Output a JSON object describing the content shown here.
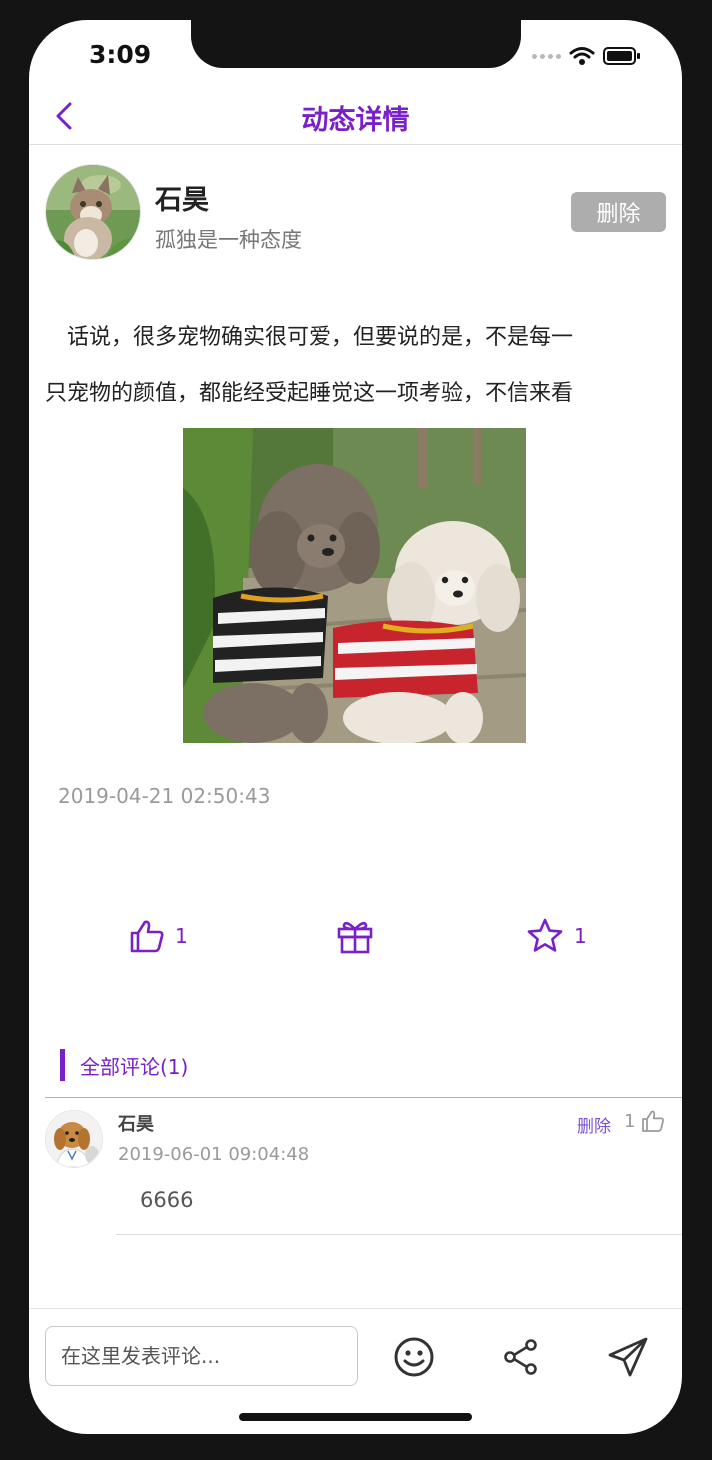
{
  "status_bar": {
    "time": "3:09"
  },
  "nav": {
    "title": "动态详情"
  },
  "post": {
    "author_name": "石昊",
    "author_bio": "孤独是一种态度",
    "delete_label": "删除",
    "text_line1": "话说，很多宠物确实很可爱，但要说的是，不是每一",
    "text_line2": "只宠物的颜值，都能经受起睡觉这一项考验，不信来看",
    "timestamp": "2019-04-21 02:50:43",
    "like_count": "1",
    "favorite_count": "1"
  },
  "comments": {
    "title": "全部评论(1)",
    "items": [
      {
        "name": "石昊",
        "time": "2019-06-01 09:04:48",
        "delete_label": "删除",
        "like_count": "1",
        "text": "6666"
      }
    ]
  },
  "composer": {
    "placeholder": "在这里发表评论..."
  },
  "colors": {
    "accent": "#7a20c8",
    "delete_bg": "#adadad",
    "frame": "#141414"
  },
  "icons": [
    "back-icon",
    "thumbs-up-icon",
    "gift-icon",
    "star-icon",
    "emoji-icon",
    "share-icon",
    "send-icon"
  ]
}
